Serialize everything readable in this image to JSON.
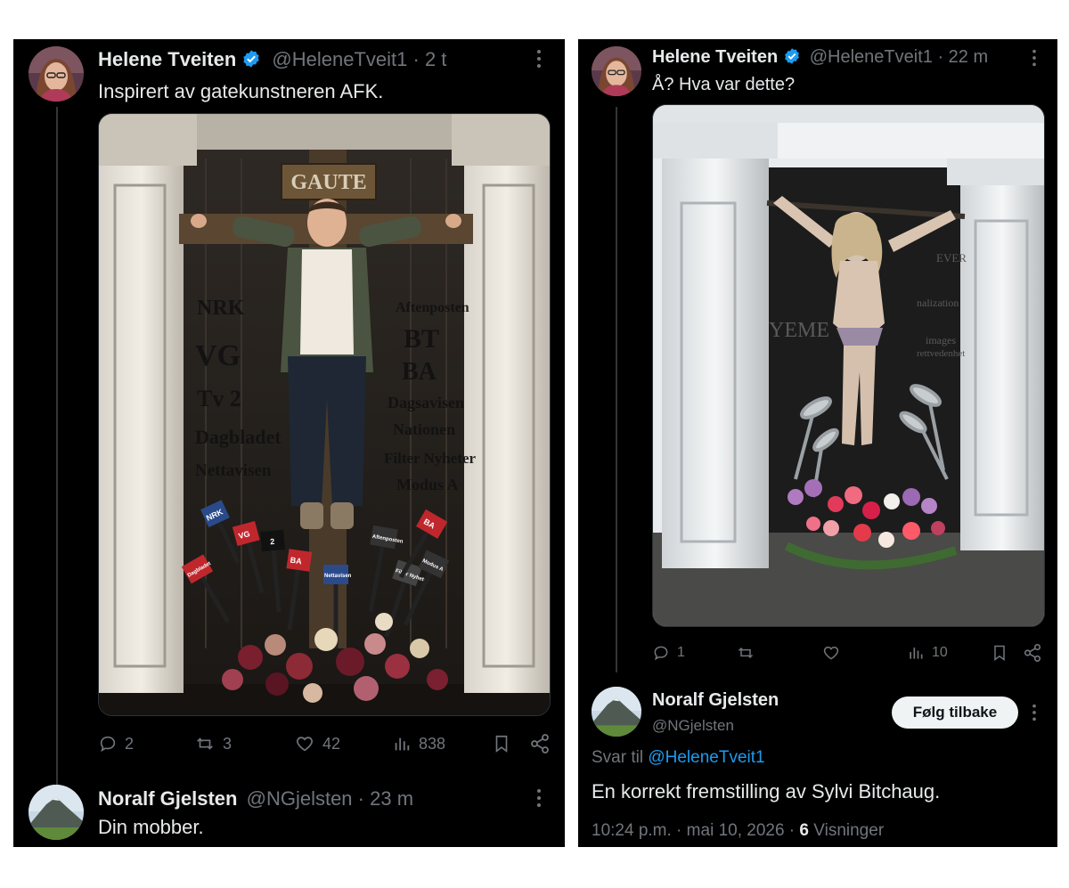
{
  "left": {
    "tweet": {
      "author_name": "Helene Tveiten",
      "handle": "@HeleneTveit1",
      "time": "2 t",
      "text": "Inspirert av gatekunstneren AFK.",
      "image": {
        "sign": "GAUTE",
        "left_outlets": [
          "NRK",
          "VG",
          "Tv 2",
          "Dagbladet",
          "Nettavisen"
        ],
        "right_outlets": [
          "Aftenposten",
          "BT",
          "BA",
          "Dagsavisen",
          "Nationen",
          "Filter Nyheter",
          "Modus A"
        ],
        "mic_labels": [
          "NRK",
          "VG",
          "2",
          "BA",
          "Dagbladet",
          "Nettavisen",
          "Aftenposten",
          "Filter Nyheter",
          "Modus A",
          "BA"
        ]
      },
      "stats": {
        "replies": "2",
        "reposts": "3",
        "likes": "42",
        "views": "838"
      }
    },
    "reply": {
      "author_name": "Noralf Gjelsten",
      "handle": "@NGjelsten",
      "time": "23 m",
      "text": "Din mobber."
    }
  },
  "right": {
    "tweet": {
      "author_name": "Helene Tveiten",
      "handle": "@HeleneTveit1",
      "time": "22 m",
      "text": "Å? Hva var dette?",
      "image": {
        "wall_words": [
          "YEME",
          "nalization",
          "images",
          "rettvedenhet",
          "EVER"
        ]
      },
      "stats": {
        "replies": "1",
        "reposts": "",
        "likes": "",
        "views": "10"
      }
    },
    "reply": {
      "author_name": "Noralf Gjelsten",
      "handle": "@NGjelsten",
      "follow_label": "Følg tilbake",
      "reply_to_prefix": "Svar til",
      "reply_to_handle": "@HeleneTveit1",
      "text": "En korrekt fremstilling av Sylvi Bitchaug.",
      "time": "10:24 p.m.",
      "date": "mai 10, 2026",
      "views_count": "6",
      "views_label": "Visninger"
    }
  },
  "colors": {
    "background": "#000000",
    "text": "#e7e9ea",
    "muted": "#71767b",
    "link": "#1d9bf0",
    "verified": "#1d9bf0",
    "button_bg": "#eff3f4"
  },
  "icons": [
    "verified-badge-icon",
    "more-icon",
    "reply-icon",
    "repost-icon",
    "like-icon",
    "views-icon",
    "bookmark-icon",
    "share-icon"
  ]
}
